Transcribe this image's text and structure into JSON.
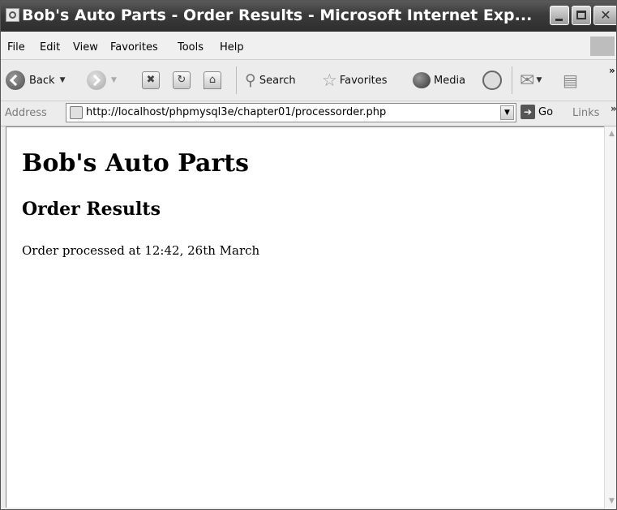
{
  "window": {
    "title": "Bob's Auto Parts - Order Results - Microsoft Internet Exp..."
  },
  "menu": {
    "items": [
      "File",
      "Edit",
      "View",
      "Favorites",
      "Tools",
      "Help"
    ]
  },
  "toolbar": {
    "back_label": "Back",
    "search_label": "Search",
    "favorites_label": "Favorites",
    "media_label": "Media",
    "more_label": "»"
  },
  "address": {
    "label": "Address",
    "url": "http://localhost/phpmysql3e/chapter01/processorder.php",
    "go_label": "Go",
    "links_label": "Links",
    "links_more": "»"
  },
  "page": {
    "heading": "Bob's Auto Parts",
    "subheading": "Order Results",
    "message": "Order processed at 12:42, 26th March"
  }
}
